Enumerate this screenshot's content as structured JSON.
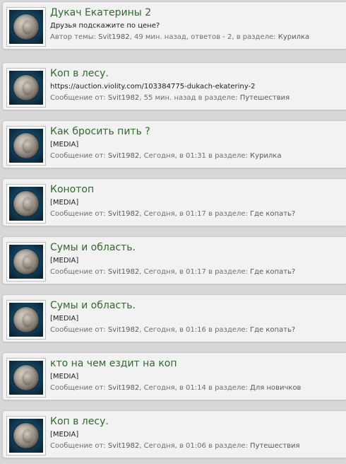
{
  "results": [
    {
      "title": "Дукач Екатерины 2",
      "snippet": "Друзья подскажите по цене?",
      "meta_prefix": "Автор темы: ",
      "author": "Svit1982",
      "meta_mid": ", 49 мин. назад, ответов - 2, в разделе: ",
      "section": "Курилка"
    },
    {
      "title": "Коп в лесу.",
      "snippet": "https://auction.violity.com/103384775-dukach-ekateriny-2",
      "meta_prefix": "Сообщение от: ",
      "author": "Svit1982",
      "meta_mid": ", 55 мин. назад в разделе: ",
      "section": "Путешествия"
    },
    {
      "title": "Как бросить пить ?",
      "snippet": "[MEDIA]",
      "meta_prefix": "Сообщение от: ",
      "author": "Svit1982",
      "meta_mid": ", Сегодня, в 01:31 в разделе: ",
      "section": "Курилка"
    },
    {
      "title": "Конотоп",
      "snippet": "[MEDIA]",
      "meta_prefix": "Сообщение от: ",
      "author": "Svit1982",
      "meta_mid": ", Сегодня, в 01:17 в разделе: ",
      "section": "Где копать?"
    },
    {
      "title": "Сумы и область.",
      "snippet": "[MEDIA]",
      "meta_prefix": "Сообщение от: ",
      "author": "Svit1982",
      "meta_mid": ", Сегодня, в 01:17 в разделе: ",
      "section": "Где копать?"
    },
    {
      "title": "Сумы и область.",
      "snippet": "[MEDIA]",
      "meta_prefix": "Сообщение от: ",
      "author": "Svit1982",
      "meta_mid": ", Сегодня, в 01:16 в разделе: ",
      "section": "Где копать?"
    },
    {
      "title": "кто на чем ездит на коп",
      "snippet": "[MEDIA]",
      "meta_prefix": "Сообщение от: ",
      "author": "Svit1982",
      "meta_mid": ", Сегодня, в 01:14 в разделе: ",
      "section": "Для новичков"
    },
    {
      "title": "Коп в лесу.",
      "snippet": "[MEDIA]",
      "meta_prefix": "Сообщение от: ",
      "author": "Svit1982",
      "meta_mid": ", Сегодня, в 01:06 в разделе: ",
      "section": "Путешествия"
    }
  ],
  "colors": {
    "title": "#2f6b2a",
    "meta": "#6f6f6f",
    "background": "#d8d8d8",
    "card": "#f2f2f2"
  },
  "icons": {
    "avatar": "coin-avatar-icon"
  }
}
